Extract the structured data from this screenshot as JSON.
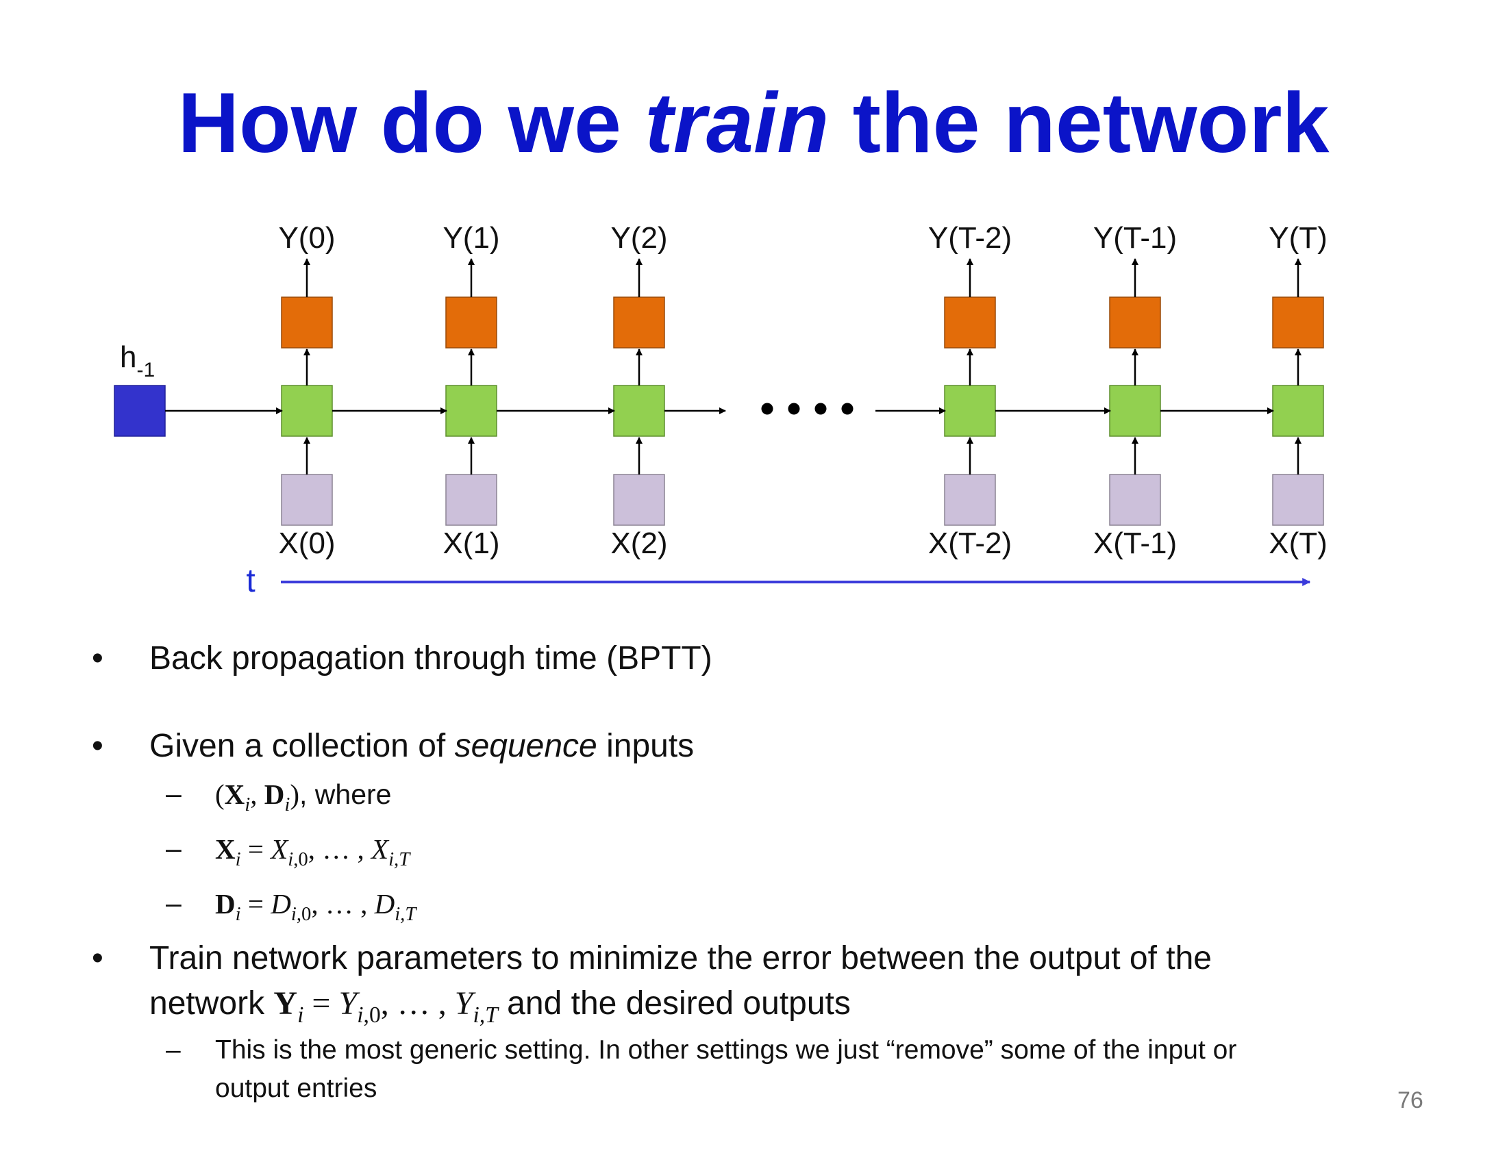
{
  "title": {
    "pre": "How do we ",
    "emph": "train",
    "post": " the network"
  },
  "diagram": {
    "initial_state": {
      "label": "h",
      "subscript": "-1"
    },
    "outputs": [
      "Y(0)",
      "Y(1)",
      "Y(2)",
      "Y(T-2)",
      "Y(T-1)",
      "Y(T)"
    ],
    "inputs": [
      "X(0)",
      "X(1)",
      "X(2)",
      "X(T-2)",
      "X(T-1)",
      "X(T)"
    ],
    "time_axis_label": "t",
    "colors": {
      "initial_state": "#3333cc",
      "hidden": "#92d050",
      "output": "#e36c09",
      "input": "#ccc0da",
      "time_axis": "#3b3bdb",
      "title": "#0b14c8"
    }
  },
  "bullets": {
    "b1": "Back propagation through time (BPTT)",
    "b2": {
      "pre": "Given a collection of ",
      "emph": "sequence",
      "post": " inputs"
    },
    "b2_sub1_suffix": ",  where",
    "b3_line1": "Train network parameters to minimize the error between the output of the",
    "b3_line2_pre": "network ",
    "b3_line2_post": " and the desired outputs",
    "b3_sub1_line1": "This is the most generic setting. In other settings we just “remove” some of the input or",
    "b3_sub1_line2": "output entries"
  },
  "page_number": "76"
}
